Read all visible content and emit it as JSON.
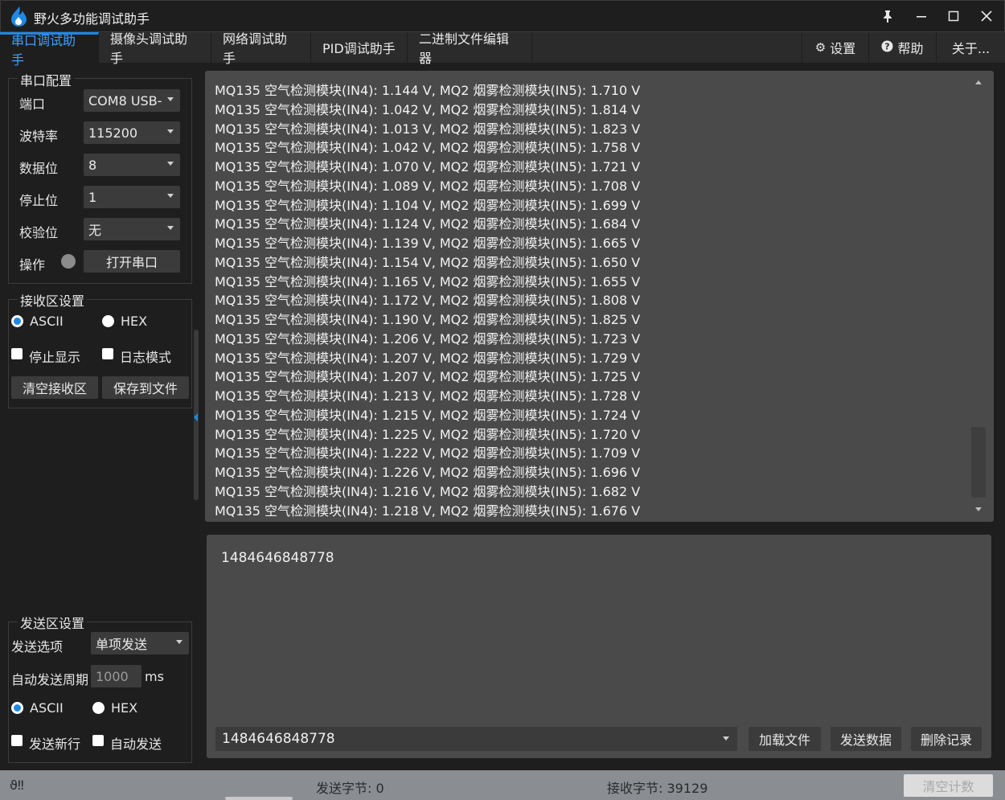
{
  "window": {
    "title": "野火多功能调试助手",
    "pin_icon": "pin-icon",
    "minimize_icon": "minimize-icon",
    "maximize_icon": "maximize-icon",
    "close_icon": "close-icon"
  },
  "tabs": [
    {
      "label": "串口调试助手",
      "active": true
    },
    {
      "label": "摄像头调试助手",
      "active": false
    },
    {
      "label": "网络调试助手",
      "active": false
    },
    {
      "label": "PID调试助手",
      "active": false
    },
    {
      "label": "二进制文件编辑器",
      "active": false
    }
  ],
  "right_tabs": {
    "settings": "设置",
    "help": "帮助",
    "about": "关于..."
  },
  "serial_config": {
    "title": "串口配置",
    "port_label": "端口",
    "port_value": "COM8 USB-",
    "baud_label": "波特率",
    "baud_value": "115200",
    "databits_label": "数据位",
    "databits_value": "8",
    "stopbits_label": "停止位",
    "stopbits_value": "1",
    "parity_label": "校验位",
    "parity_value": "无",
    "operation_label": "操作",
    "open_button": "打开串口"
  },
  "recv_settings": {
    "title": "接收区设置",
    "ascii": "ASCII",
    "hex": "HEX",
    "stop_display": "停止显示",
    "log_mode": "日志模式",
    "clear_button": "清空接收区",
    "save_button": "保存到文件"
  },
  "send_settings": {
    "title": "发送区设置",
    "option_label": "发送选项",
    "option_value": "单项发送",
    "period_label": "自动发送周期",
    "period_value": "1000",
    "period_unit": "ms",
    "ascii": "ASCII",
    "hex": "HEX",
    "newline": "发送新行",
    "auto_send": "自动发送"
  },
  "recv_lines": [
    "MQ135 空气检测模块(IN4): 1.144 V, MQ2 烟雾检测模块(IN5): 1.710 V",
    "MQ135 空气检测模块(IN4): 1.042 V, MQ2 烟雾检测模块(IN5): 1.814 V",
    "MQ135 空气检测模块(IN4): 1.013 V, MQ2 烟雾检测模块(IN5): 1.823 V",
    "MQ135 空气检测模块(IN4): 1.042 V, MQ2 烟雾检测模块(IN5): 1.758 V",
    "MQ135 空气检测模块(IN4): 1.070 V, MQ2 烟雾检测模块(IN5): 1.721 V",
    "MQ135 空气检测模块(IN4): 1.089 V, MQ2 烟雾检测模块(IN5): 1.708 V",
    "MQ135 空气检测模块(IN4): 1.104 V, MQ2 烟雾检测模块(IN5): 1.699 V",
    "MQ135 空气检测模块(IN4): 1.124 V, MQ2 烟雾检测模块(IN5): 1.684 V",
    "MQ135 空气检测模块(IN4): 1.139 V, MQ2 烟雾检测模块(IN5): 1.665 V",
    "MQ135 空气检测模块(IN4): 1.154 V, MQ2 烟雾检测模块(IN5): 1.650 V",
    "MQ135 空气检测模块(IN4): 1.165 V, MQ2 烟雾检测模块(IN5): 1.655 V",
    "MQ135 空气检测模块(IN4): 1.172 V, MQ2 烟雾检测模块(IN5): 1.808 V",
    "MQ135 空气检测模块(IN4): 1.190 V, MQ2 烟雾检测模块(IN5): 1.825 V",
    "MQ135 空气检测模块(IN4): 1.206 V, MQ2 烟雾检测模块(IN5): 1.723 V",
    "MQ135 空气检测模块(IN4): 1.207 V, MQ2 烟雾检测模块(IN5): 1.729 V",
    "MQ135 空气检测模块(IN4): 1.207 V, MQ2 烟雾检测模块(IN5): 1.725 V",
    "MQ135 空气检测模块(IN4): 1.213 V, MQ2 烟雾检测模块(IN5): 1.728 V",
    "MQ135 空气检测模块(IN4): 1.215 V, MQ2 烟雾检测模块(IN5): 1.724 V",
    "MQ135 空气检测模块(IN4): 1.225 V, MQ2 烟雾检测模块(IN5): 1.720 V",
    "MQ135 空气检测模块(IN4): 1.222 V, MQ2 烟雾检测模块(IN5): 1.709 V",
    "MQ135 空气检测模块(IN4): 1.226 V, MQ2 烟雾检测模块(IN5): 1.696 V",
    "MQ135 空气检测模块(IN4): 1.216 V, MQ2 烟雾检测模块(IN5): 1.682 V",
    "MQ135 空气检测模块(IN4): 1.218 V, MQ2 烟雾检测模块(IN5): 1.676 V"
  ],
  "send_area": {
    "text": "1484646848778",
    "history_value": "1484646848778",
    "load_file": "加载文件",
    "send_data": "发送数据",
    "delete_history": "删除记录"
  },
  "status": {
    "left": "ϑ‼",
    "sent_bytes": "发送字节: 0",
    "recv_bytes": "接收字节: 39129",
    "clear_count": "清空计数"
  },
  "colors": {
    "accent": "#1e88e5",
    "background": "#1e1e1e",
    "text_area": "#4a4a4a"
  }
}
